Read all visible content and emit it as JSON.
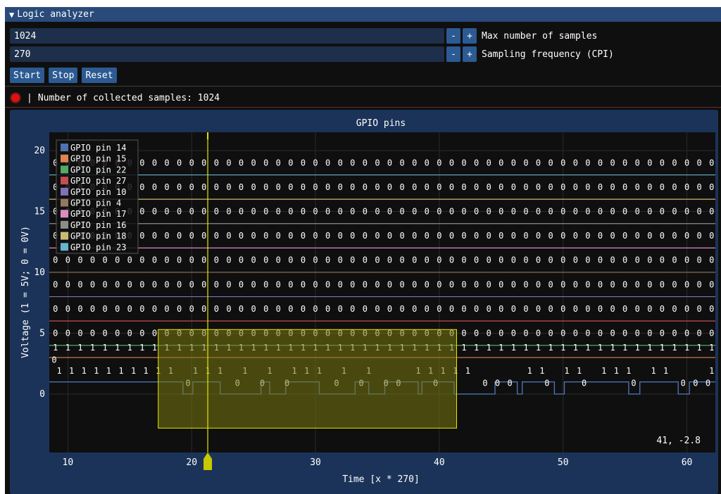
{
  "window": {
    "title": "Logic analyzer",
    "collapse_icon": "triangle-down-icon"
  },
  "controls": {
    "max_samples": {
      "value": "1024",
      "minus": "-",
      "plus": "+",
      "label": "Max number of samples"
    },
    "sampling_freq": {
      "value": "270",
      "minus": "-",
      "plus": "+",
      "label": "Sampling frequency (CPI)"
    },
    "buttons": {
      "start": "Start",
      "stop": "Stop",
      "reset": "Reset"
    }
  },
  "status": {
    "separator": "|",
    "text": "Number of collected samples: 1024",
    "dot_color": "#e01010"
  },
  "chart_data": {
    "type": "line",
    "title": "GPIO pins",
    "xlabel": "Time [x * 270]",
    "ylabel": "Voltage (1 = 5V; 0 = 0V)",
    "xlim": [
      8.5,
      62.3
    ],
    "ylim": [
      -4.8,
      21.5
    ],
    "x_ticks": [
      10,
      20,
      30,
      40,
      50,
      60
    ],
    "y_ticks": [
      0,
      5,
      10,
      15,
      20
    ],
    "grid": true,
    "legend_position": "top-left",
    "series": [
      {
        "name": "GPIO pin 14",
        "color": "#4c72b0",
        "level": 1.0
      },
      {
        "name": "GPIO pin 15",
        "color": "#dd8452",
        "level": 3.0
      },
      {
        "name": "GPIO pin 22",
        "color": "#55a868",
        "level": 4.0
      },
      {
        "name": "GPIO pin 27",
        "color": "#c44e52",
        "level": 6.0
      },
      {
        "name": "GPIO pin 10",
        "color": "#8172b3",
        "level": 8.0
      },
      {
        "name": "GPIO pin 4",
        "color": "#937860",
        "level": 10.0
      },
      {
        "name": "GPIO pin 17",
        "color": "#da8bc3",
        "level": 12.0
      },
      {
        "name": "GPIO pin 16",
        "color": "#8c8c8c",
        "level": 14.0
      },
      {
        "name": "GPIO pin 18",
        "color": "#ccb974",
        "level": 16.0
      },
      {
        "name": "GPIO pin 23",
        "color": "#64b5cd",
        "level": 18.0
      }
    ],
    "pin14_high_intervals": [
      [
        8.5,
        19.3
      ],
      [
        20.1,
        22.3
      ],
      [
        25.6,
        26.3
      ],
      [
        27.6,
        30.3
      ],
      [
        33.2,
        34.3
      ],
      [
        35.6,
        38.3
      ],
      [
        38.6,
        41.2
      ],
      [
        44.5,
        46.3
      ],
      [
        46.7,
        49.3
      ],
      [
        50.1,
        55.3
      ],
      [
        56.2,
        59.3
      ],
      [
        60.2,
        62.3
      ]
    ],
    "pin14_labels": [
      {
        "x": 9.3,
        "t": "1"
      },
      {
        "x": 10.3,
        "t": "1"
      },
      {
        "x": 11.3,
        "t": "1"
      },
      {
        "x": 12.3,
        "t": "1"
      },
      {
        "x": 13.3,
        "t": "1"
      },
      {
        "x": 14.3,
        "t": "1"
      },
      {
        "x": 15.3,
        "t": "1"
      },
      {
        "x": 16.3,
        "t": "1"
      },
      {
        "x": 17.3,
        "t": "1"
      },
      {
        "x": 18.3,
        "t": "1"
      },
      {
        "x": 19.7,
        "t": "0"
      },
      {
        "x": 20.3,
        "t": "1"
      },
      {
        "x": 21.3,
        "t": "1"
      },
      {
        "x": 22.3,
        "t": "1"
      },
      {
        "x": 23.7,
        "t": "0"
      },
      {
        "x": 24.3,
        "t": "1"
      },
      {
        "x": 25.7,
        "t": "0"
      },
      {
        "x": 26.3,
        "t": "1"
      },
      {
        "x": 27.7,
        "t": "0"
      },
      {
        "x": 28.3,
        "t": "1"
      },
      {
        "x": 29.3,
        "t": "1"
      },
      {
        "x": 30.3,
        "t": "1"
      },
      {
        "x": 31.7,
        "t": "0"
      },
      {
        "x": 32.3,
        "t": "1"
      },
      {
        "x": 33.7,
        "t": "0"
      },
      {
        "x": 34.3,
        "t": "1"
      },
      {
        "x": 35.7,
        "t": "0"
      },
      {
        "x": 36.7,
        "t": "0"
      },
      {
        "x": 38.3,
        "t": "1"
      },
      {
        "x": 39.3,
        "t": "1"
      },
      {
        "x": 39.7,
        "t": "0"
      },
      {
        "x": 40.3,
        "t": "1"
      },
      {
        "x": 41.3,
        "t": "1"
      },
      {
        "x": 42.3,
        "t": "1"
      },
      {
        "x": 43.7,
        "t": "0"
      },
      {
        "x": 44.7,
        "t": "0"
      },
      {
        "x": 45.7,
        "t": "0"
      },
      {
        "x": 47.3,
        "t": "1"
      },
      {
        "x": 48.3,
        "t": "1"
      },
      {
        "x": 48.7,
        "t": "0"
      },
      {
        "x": 50.3,
        "t": "1"
      },
      {
        "x": 51.3,
        "t": "1"
      },
      {
        "x": 51.7,
        "t": "0"
      },
      {
        "x": 53.3,
        "t": "1"
      },
      {
        "x": 54.3,
        "t": "1"
      },
      {
        "x": 55.3,
        "t": "1"
      },
      {
        "x": 55.7,
        "t": "0"
      },
      {
        "x": 57.3,
        "t": "1"
      },
      {
        "x": 58.3,
        "t": "1"
      },
      {
        "x": 59.7,
        "t": "0"
      },
      {
        "x": 60.7,
        "t": "0"
      },
      {
        "x": 61.7,
        "t": "0"
      },
      {
        "x": 62.0,
        "t": "1"
      }
    ],
    "selection_rect": {
      "x0": 17.3,
      "x1": 41.4,
      "y0": -2.8,
      "y1": 5.3,
      "fill": "#7a7a10",
      "stroke": "#e6e600"
    },
    "cursor_x": 21.3,
    "mouse_readout": "41, -2.8"
  }
}
